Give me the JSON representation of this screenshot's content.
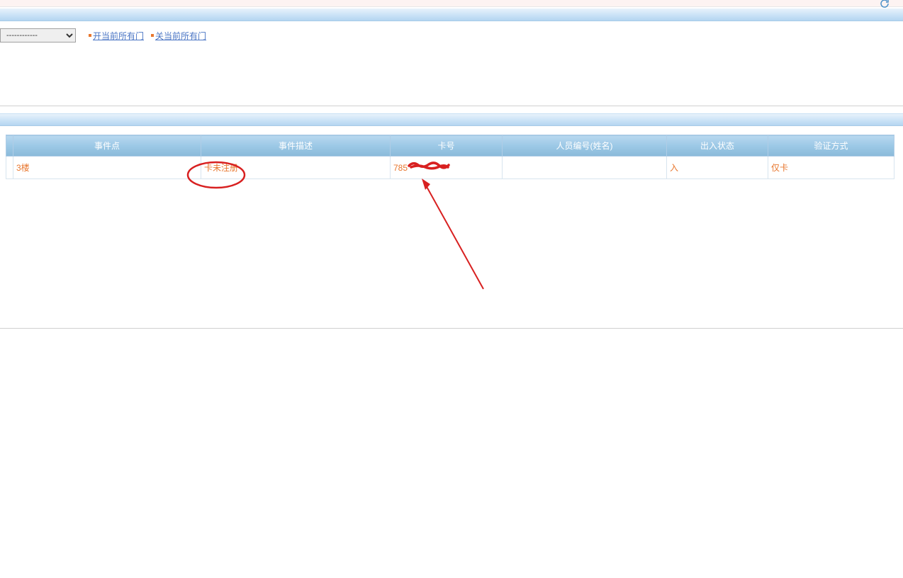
{
  "toolbar": {
    "select_placeholder": "------------",
    "open_all_doors": "开当前所有门",
    "close_all_doors": "关当前所有门"
  },
  "table": {
    "headers": {
      "event_point": "事件点",
      "event_desc": "事件描述",
      "card_no": "卡号",
      "person_id": "人员编号(姓名)",
      "in_out_status": "出入状态",
      "verify_method": "验证方式"
    },
    "rows": [
      {
        "event_point": "3楼",
        "event_desc": "卡未注册",
        "card_no": "785",
        "person_id": "",
        "in_out_status": "入",
        "verify_method": "仅卡"
      }
    ]
  }
}
